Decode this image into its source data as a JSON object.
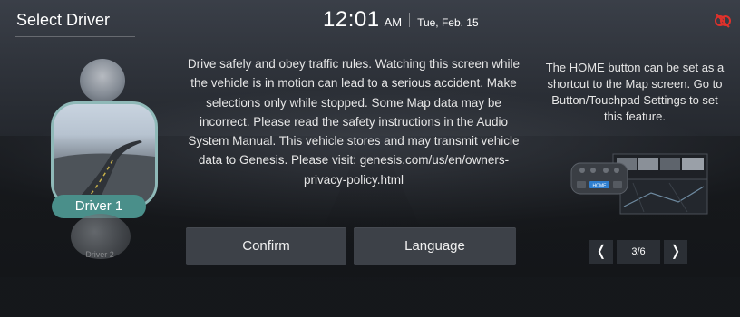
{
  "header": {
    "title": "Select Driver",
    "time": "12:01",
    "ampm": "AM",
    "date": "Tue, Feb. 15",
    "status_icon": "connection-off-icon",
    "status_color": "#e0312b"
  },
  "drivers": {
    "selected_label": "Driver 1",
    "secondary_label": "Driver 2",
    "accent_color": "#4a8f8a"
  },
  "warning": {
    "text": "Drive safely and obey traffic rules. Watching this screen while the vehicle is in motion can lead to a serious accident. Make selections only while stopped. Some Map data may be incorrect. Please read the safety instructions in the Audio System Manual. This vehicle stores and may transmit vehicle data to Genesis. Please visit: genesis.com/us/en/owners-privacy-policy.html"
  },
  "buttons": {
    "confirm": "Confirm",
    "language": "Language"
  },
  "tip": {
    "text": "The HOME button can be set as a shortcut to the Map screen. Go to Button/Touchpad Settings to set this feature.",
    "illustration_button_label": "HOME"
  },
  "pager": {
    "prev_icon": "chevron-left-icon",
    "next_icon": "chevron-right-icon",
    "prev_symbol": "❬",
    "next_symbol": "❭",
    "page": "3/6"
  }
}
